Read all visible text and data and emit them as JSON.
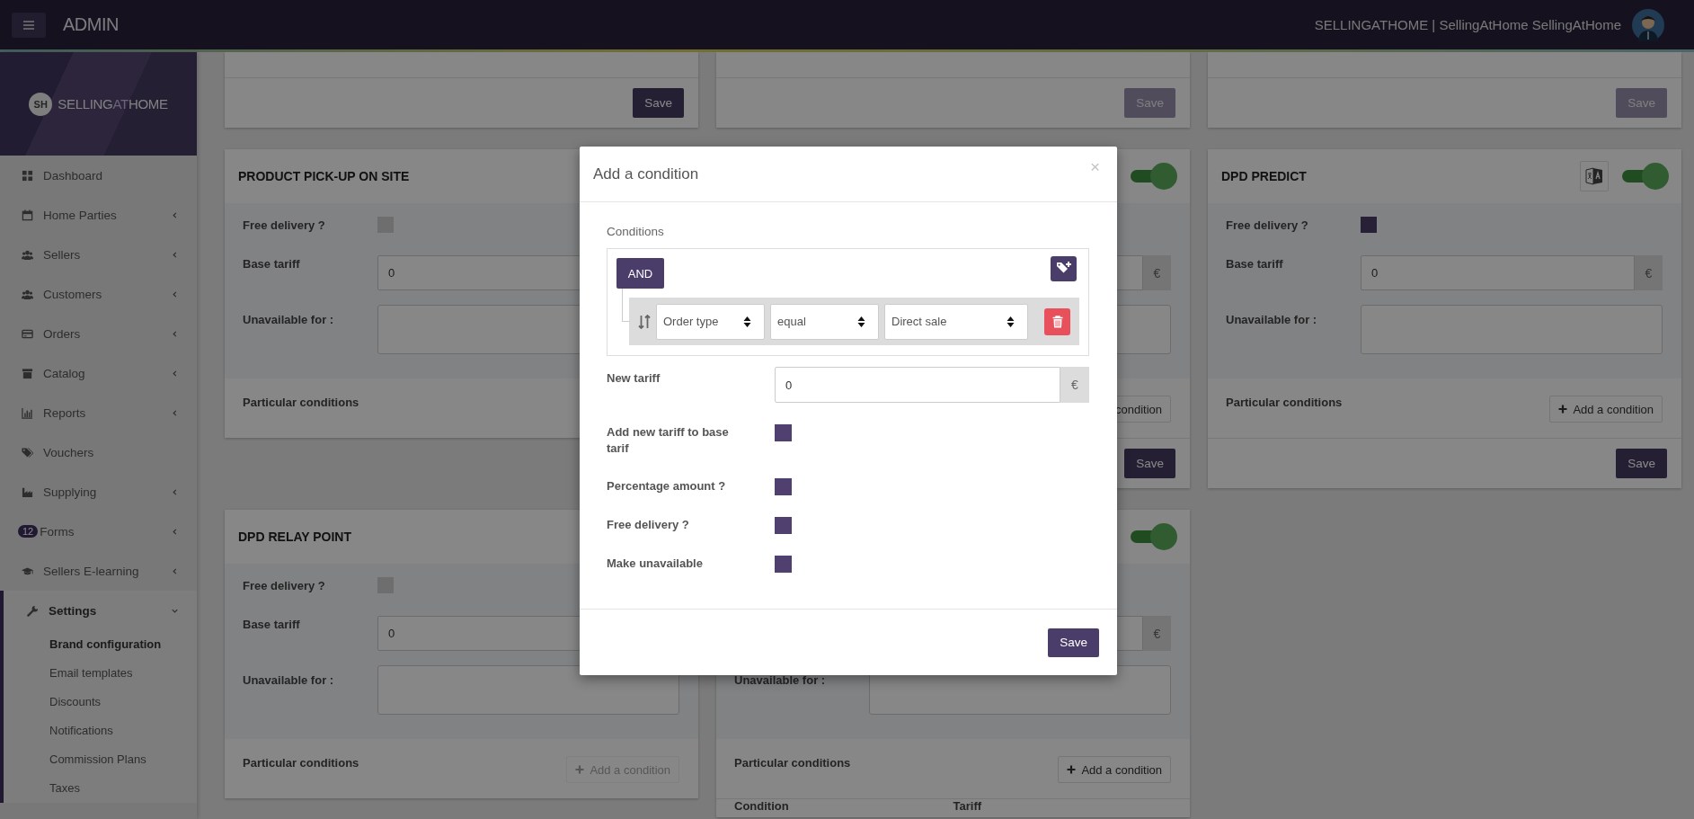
{
  "topbar": {
    "brand": "ADMIN",
    "user": "SELLINGATHOME | SellingAtHome SellingAtHome"
  },
  "sidebar": {
    "logo": {
      "badge": "SH",
      "text_parts": [
        "SELLING",
        "AT",
        "HOME"
      ]
    },
    "items": [
      {
        "label": "Dashboard",
        "has_submenu": false,
        "expanded": false,
        "selected": false
      },
      {
        "label": "Home Parties",
        "has_submenu": true,
        "expanded": false,
        "selected": false
      },
      {
        "label": "Sellers",
        "has_submenu": true,
        "expanded": false,
        "selected": false
      },
      {
        "label": "Customers",
        "has_submenu": true,
        "expanded": false,
        "selected": false
      },
      {
        "label": "Orders",
        "has_submenu": true,
        "expanded": false,
        "selected": false
      },
      {
        "label": "Catalog",
        "has_submenu": true,
        "expanded": false,
        "selected": false
      },
      {
        "label": "Reports",
        "has_submenu": true,
        "expanded": false,
        "selected": false
      },
      {
        "label": "Vouchers",
        "has_submenu": false,
        "expanded": false,
        "selected": false
      },
      {
        "label": "Supplying",
        "has_submenu": true,
        "expanded": false,
        "selected": false
      },
      {
        "label": "Forms",
        "badge": "12",
        "has_submenu": true,
        "expanded": false,
        "selected": false
      },
      {
        "label": "Sellers E-learning",
        "has_submenu": true,
        "expanded": false,
        "selected": false
      },
      {
        "label": "Settings",
        "has_submenu": true,
        "expanded": true,
        "selected": true,
        "children": [
          {
            "label": "Brand configuration",
            "selected": true
          },
          {
            "label": "Email templates",
            "selected": false
          },
          {
            "label": "Discounts",
            "selected": false
          },
          {
            "label": "Notifications",
            "selected": false
          },
          {
            "label": "Commission Plans",
            "selected": false
          },
          {
            "label": "Taxes",
            "selected": false
          }
        ]
      }
    ]
  },
  "card_rows": [
    [
      {
        "kind": "footer_only",
        "save": {
          "label": "Save",
          "disabled": false
        }
      },
      {
        "kind": "footer_only",
        "save": {
          "label": "Save",
          "disabled": true
        }
      },
      {
        "kind": "footer_only",
        "save": {
          "label": "Save",
          "disabled": true
        }
      }
    ],
    [
      {
        "kind": "full",
        "title": "PRODUCT PICK-UP ON SITE",
        "free_delivery": {
          "label": "Free delivery ?",
          "checked": false
        },
        "base_tariff": {
          "label": "Base tariff",
          "value": "0"
        },
        "unavailable": {
          "label": "Unavailable for :"
        },
        "conditions": {
          "label": "Particular conditions"
        }
      },
      {
        "kind": "full",
        "toggle": {
          "on": true
        },
        "base_tariff": {
          "currency": "€"
        },
        "conditions": {
          "button": {
            "label": "condition",
            "disabled": false
          }
        },
        "save": {
          "label": "Save",
          "disabled": false
        }
      },
      {
        "kind": "full",
        "title": "DPD PREDICT",
        "translatable": true,
        "toggle": {
          "on": true
        },
        "free_delivery": {
          "label": "Free delivery ?",
          "checked": true
        },
        "base_tariff": {
          "label": "Base tariff",
          "value": "0",
          "currency": "€"
        },
        "unavailable": {
          "label": "Unavailable for :"
        },
        "conditions": {
          "label": "Particular conditions",
          "button": {
            "label": "Add a condition",
            "disabled": false
          }
        },
        "save": {
          "label": "Save",
          "disabled": false
        }
      }
    ],
    [
      {
        "kind": "full",
        "title": "DPD RELAY POINT",
        "free_delivery": {
          "label": "Free delivery ?",
          "checked": false
        },
        "base_tariff": {
          "label": "Base tariff",
          "value": "0"
        },
        "unavailable": {
          "label": "Unavailable for :"
        },
        "conditions": {
          "label": "Particular conditions",
          "button": {
            "label": "Add a condition",
            "disabled": true
          }
        }
      },
      {
        "kind": "full",
        "toggle": {
          "on": true
        },
        "base_tariff": {
          "currency": "€"
        },
        "unavailable": {
          "label": "Unavailable for :"
        },
        "conditions": {
          "label": "Particular conditions",
          "button": {
            "label": "Add a condition",
            "disabled": false
          }
        },
        "table_columns": [
          "Condition",
          "Tariff"
        ]
      }
    ]
  ],
  "modal": {
    "title": "Add a condition",
    "close": "×",
    "conditions_label": "Conditions",
    "group_operator": "AND",
    "rules": [
      {
        "field": "Order type",
        "operator": "equal",
        "value": "Direct sale"
      }
    ],
    "new_tariff": {
      "label": "New tariff",
      "value": "0",
      "currency": "€"
    },
    "options": [
      {
        "label": "Add new tariff to base tarif",
        "checked": true
      },
      {
        "label": "Percentage amount ?",
        "checked": true
      },
      {
        "label": "Free delivery ?",
        "checked": true
      },
      {
        "label": "Make unavailable",
        "checked": true
      }
    ],
    "save": "Save"
  }
}
